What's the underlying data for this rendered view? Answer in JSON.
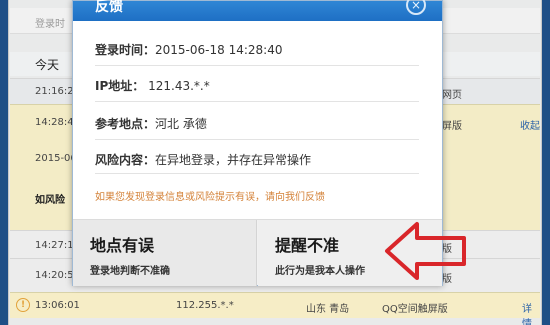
{
  "background": {
    "header_label": "登录时",
    "today_label": "今天",
    "row1": {
      "time": "21:16:2",
      "right": "网页"
    },
    "highlight": {
      "time": "14:28:4",
      "date": "2015-06",
      "risk": "如风险",
      "right": "屏版",
      "action": "收起"
    },
    "row2": {
      "time": "14:27:1",
      "right": "版"
    },
    "row3": {
      "time": "14:20:5",
      "right": "版"
    },
    "row4": {
      "warn": "!",
      "time": "13:06:01",
      "ip": "112.255.*.*",
      "location": "山东 青岛",
      "app": "QQ空间触屏版",
      "detail": "详情"
    }
  },
  "dialog": {
    "title": "反馈",
    "close_icon": "×",
    "login_time_label": "登录时间：",
    "login_time_value": "2015-06-18 14:28:40",
    "ip_label": "IP地址：",
    "ip_value": "121.43.*.*",
    "location_label": "参考地点：",
    "location_value": "河北 承德",
    "risk_label": "风险内容：",
    "risk_value": "在异地登录，并存在异常操作",
    "notice": "如果您发现登录信息或风险提示有误，请向我们反馈",
    "btn_location_wrong": {
      "title": "地点有误",
      "desc": "登录地判断不准确"
    },
    "btn_alert_wrong": {
      "title": "提醒不准",
      "desc": "此行为是我本人操作"
    }
  },
  "colors": {
    "title_bar": "#1e6fc4",
    "notice": "#d4833a",
    "arrow": "#d9262a"
  }
}
